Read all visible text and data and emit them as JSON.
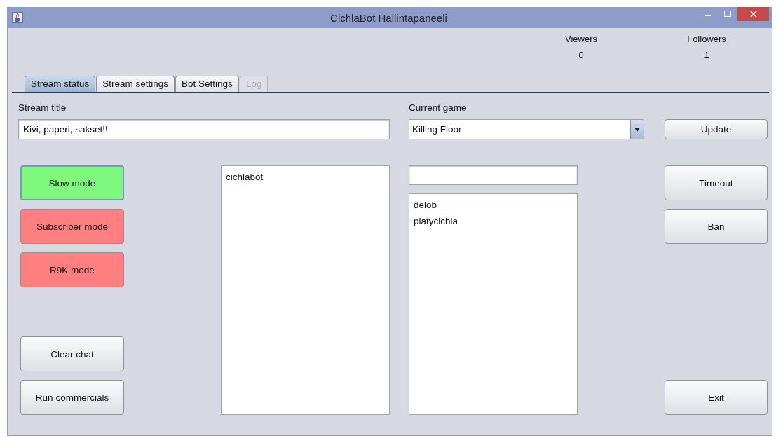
{
  "window": {
    "title": "CichlaBot Hallintapaneeli"
  },
  "stats": [
    {
      "label": "Viewers",
      "value": "0"
    },
    {
      "label": "Followers",
      "value": "1"
    }
  ],
  "tabs": [
    {
      "label": "Stream status",
      "selected": true,
      "disabled": false
    },
    {
      "label": "Stream settings",
      "selected": false,
      "disabled": false
    },
    {
      "label": "Bot Settings",
      "selected": false,
      "disabled": false
    },
    {
      "label": "Log",
      "selected": false,
      "disabled": true
    }
  ],
  "stream_title": {
    "label": "Stream title",
    "value": "Kivi, paperi, sakset!!"
  },
  "current_game": {
    "label": "Current game",
    "value": "Killing Floor"
  },
  "update_button": "Update",
  "mode_buttons": [
    {
      "label": "Slow mode",
      "on": true
    },
    {
      "label": "Subscriber mode",
      "on": false
    },
    {
      "label": "R9K mode",
      "on": false
    }
  ],
  "chat_actions": [
    "Clear chat",
    "Run commercials"
  ],
  "chat_users": [
    "cichlabot"
  ],
  "user_list": [
    "delob",
    "platycichla"
  ],
  "moderation_buttons": [
    "Timeout",
    "Ban"
  ],
  "exit_button": "Exit"
}
